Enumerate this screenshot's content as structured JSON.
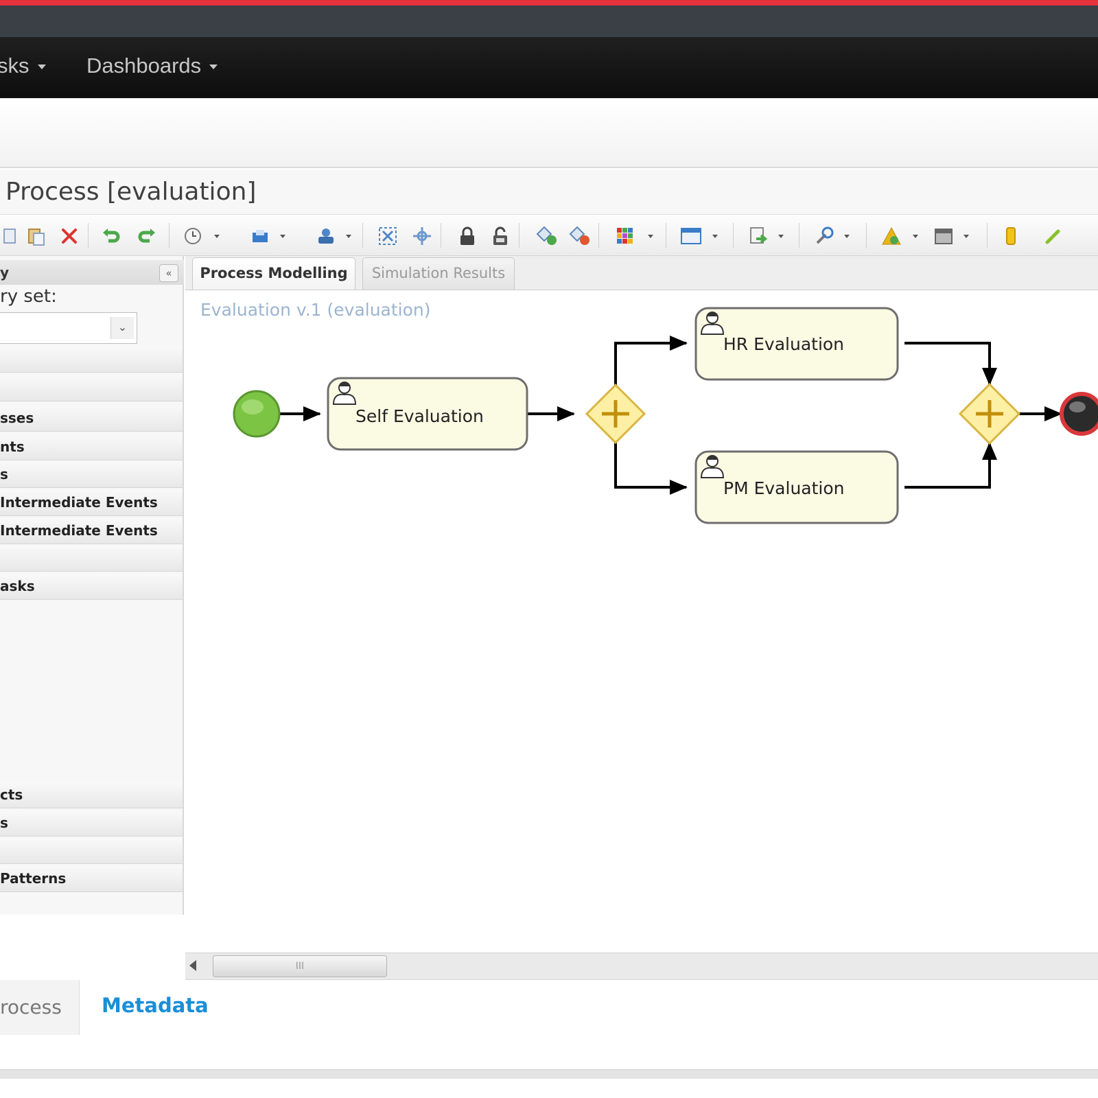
{
  "navbar": {
    "items": [
      {
        "label": "sks"
      },
      {
        "label": "Dashboards"
      }
    ]
  },
  "page": {
    "title": "Process [evaluation]"
  },
  "toolbar": {
    "icons": [
      "copy-icon",
      "paste-icon",
      "delete-icon",
      "undo-icon",
      "redo-icon",
      "clock-icon",
      "save-icon",
      "user-icon",
      "select-all-icon",
      "select-icon",
      "lock-icon",
      "unlock-icon",
      "add-node-icon",
      "remove-node-icon",
      "color-grid-icon",
      "window-icon",
      "import-icon",
      "tools-icon",
      "warning-icon",
      "calendar-icon",
      "task-icon",
      "pencil-icon"
    ],
    "colors": {
      "delete": "#e0322f",
      "undo_redo": "#4ca84a",
      "blue": "#3a7cc9",
      "lock": "#444444",
      "warning": "#e8b51c"
    }
  },
  "palette": {
    "header_title": "y",
    "collapse_label": "«",
    "set_label": "ry set:",
    "select_value": "",
    "rows": [
      "",
      "",
      "sses",
      "nts",
      "s",
      "Intermediate Events",
      "Intermediate Events",
      "",
      "asks",
      "cts",
      "s",
      "",
      "Patterns"
    ]
  },
  "tabs": {
    "process_modelling": "Process Modelling",
    "simulation_results": "Simulation Results"
  },
  "diagram": {
    "label": "Evaluation v.1 (evaluation)",
    "tasks": {
      "self": "Self Evaluation",
      "hr": "HR Evaluation",
      "pm": "PM Evaluation"
    },
    "colors": {
      "task_fill": "#fbfbe4",
      "gateway_fill": "#fdf0a4",
      "gateway_stroke": "#d8b542",
      "gateway_plus": "#c28f09",
      "start_fill": "#7cc444",
      "end_stroke": "#d9383a"
    }
  },
  "scroll": {
    "thumb_grip": "III"
  },
  "bottom_tabs": {
    "process": "rocess",
    "metadata": "Metadata"
  }
}
